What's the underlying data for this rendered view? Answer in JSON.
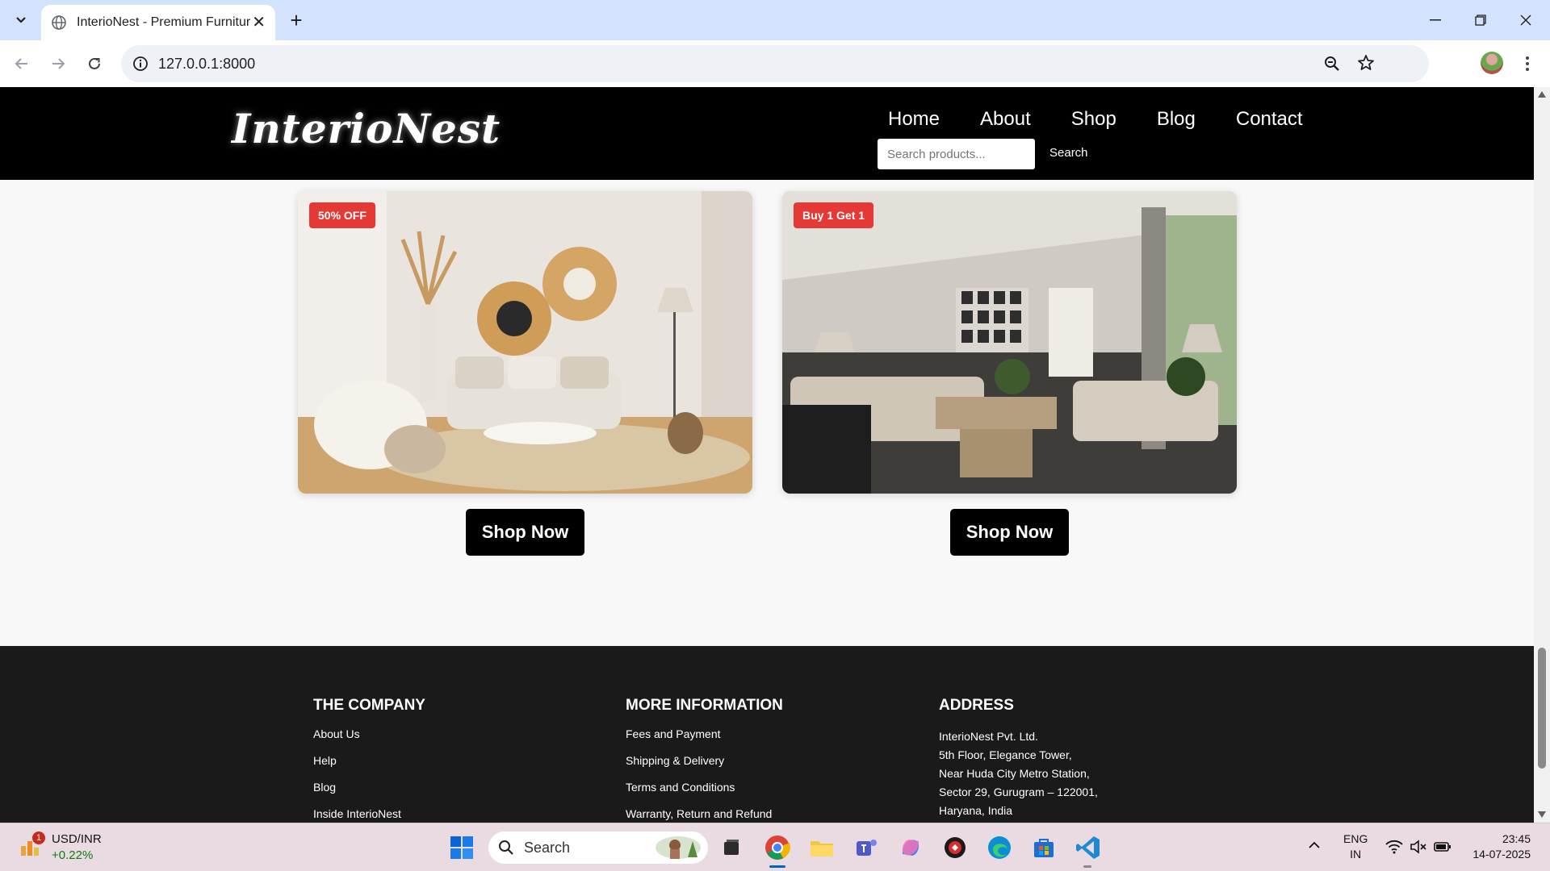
{
  "browser": {
    "tab_title": "InterioNest - Premium Furniture",
    "url": "127.0.0.1:8000"
  },
  "site": {
    "logo": "InterioNest",
    "nav": [
      "Home",
      "About",
      "Shop",
      "Blog",
      "Contact"
    ],
    "search_placeholder": "Search products...",
    "search_button": "Search"
  },
  "offers": [
    {
      "badge": "50% OFF",
      "button": "Shop Now"
    },
    {
      "badge": "Buy 1 Get 1",
      "button": "Shop Now"
    }
  ],
  "footer": {
    "company": {
      "title": "THE COMPANY",
      "links": [
        "About Us",
        "Help",
        "Blog",
        "Inside InterioNest"
      ]
    },
    "info": {
      "title": "MORE INFORMATION",
      "links": [
        "Fees and Payment",
        "Shipping & Delivery",
        "Terms and Conditions",
        "Warranty, Return and Refund"
      ]
    },
    "address": {
      "title": "ADDRESS",
      "lines": [
        "InterioNest Pvt. Ltd.",
        "5th Floor, Elegance Tower,",
        "Near Huda City Metro Station,",
        "Sector 29, Gurugram – 122001,",
        "Haryana, India"
      ]
    }
  },
  "taskbar": {
    "ticker_name": "USD/INR",
    "ticker_change": "+0.22%",
    "ticker_badge": "1",
    "search_label": "Search",
    "lang_top": "ENG",
    "lang_bottom": "IN",
    "time": "23:45",
    "date": "14-07-2025"
  },
  "colors": {
    "header_bg": "#000000",
    "badge_red": "#e53935",
    "footer_bg": "#1a1a1a",
    "ticker_green": "#107c10"
  }
}
